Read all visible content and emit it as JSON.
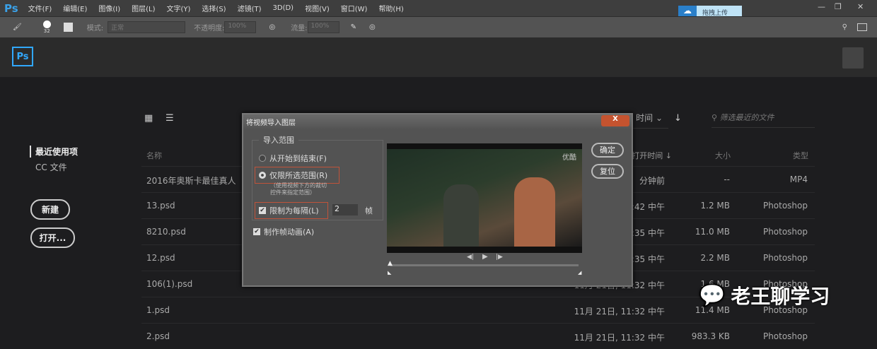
{
  "app": {
    "logo": "Ps",
    "menu": [
      "文件(F)",
      "编辑(E)",
      "图像(I)",
      "图层(L)",
      "文字(Y)",
      "选择(S)",
      "滤镜(T)",
      "3D(D)",
      "视图(V)",
      "窗口(W)",
      "帮助(H)"
    ],
    "upload_label": "拖拽上传",
    "window_controls": [
      "—",
      "❐",
      "✕"
    ]
  },
  "toolbar": {
    "brush_size": "32",
    "mode_label": "模式:",
    "mode_value": "正常",
    "opacity_label": "不透明度:",
    "opacity_value": "100%",
    "flow_label": "流量:",
    "flow_value": "100%"
  },
  "home": {
    "ps_badge": "Ps",
    "sidebar": {
      "active": "最近使用项",
      "cc": "CC 文件",
      "new_btn": "新建",
      "open_btn": "打开..."
    },
    "sort_label": "时间",
    "filter_placeholder": "筛选最近的文件",
    "columns": {
      "name": "名称",
      "date": "打开时间 ↓",
      "size": "大小",
      "type": "类型"
    },
    "rows": [
      {
        "name": "2016年奥斯卡最佳真人",
        "date": "分钟前",
        "size": "--",
        "type": "MP4"
      },
      {
        "name": "13.psd",
        "date": "11月 21日, 11:42 中午",
        "size": "1.2 MB",
        "type": "Photoshop"
      },
      {
        "name": "8210.psd",
        "date": "11月 21日, 11:35 中午",
        "size": "11.0 MB",
        "type": "Photoshop"
      },
      {
        "name": "12.psd",
        "date": "11月 21日, 11:35 中午",
        "size": "2.2 MB",
        "type": "Photoshop"
      },
      {
        "name": "106(1).psd",
        "date": "11月 21日, 11:32 中午",
        "size": "1.6 MB",
        "type": "Photoshop"
      },
      {
        "name": "1.psd",
        "date": "11月 21日, 11:32 中午",
        "size": "11.4 MB",
        "type": "Photoshop"
      },
      {
        "name": "2.psd",
        "date": "11月 21日, 11:32 中午",
        "size": "983.3 KB",
        "type": "Photoshop"
      }
    ]
  },
  "dialog": {
    "title": "将视频导入图层",
    "close": "X",
    "group_label": "导入范围",
    "opt_all": "从开始到结束(F)",
    "opt_selected": "仅限所选范围(R)",
    "hint": "（使用视频下方的裁切\n控件来指定范围）",
    "limit_label": "限制为每隔(L)",
    "limit_value": "2",
    "frames_unit": "帧",
    "animation_label": "制作帧动画(A)",
    "ok": "确定",
    "reset": "复位",
    "watermark": "优酷",
    "controls": [
      "◀|",
      "▶",
      "|▶"
    ]
  },
  "watermark": "老王聊学习"
}
